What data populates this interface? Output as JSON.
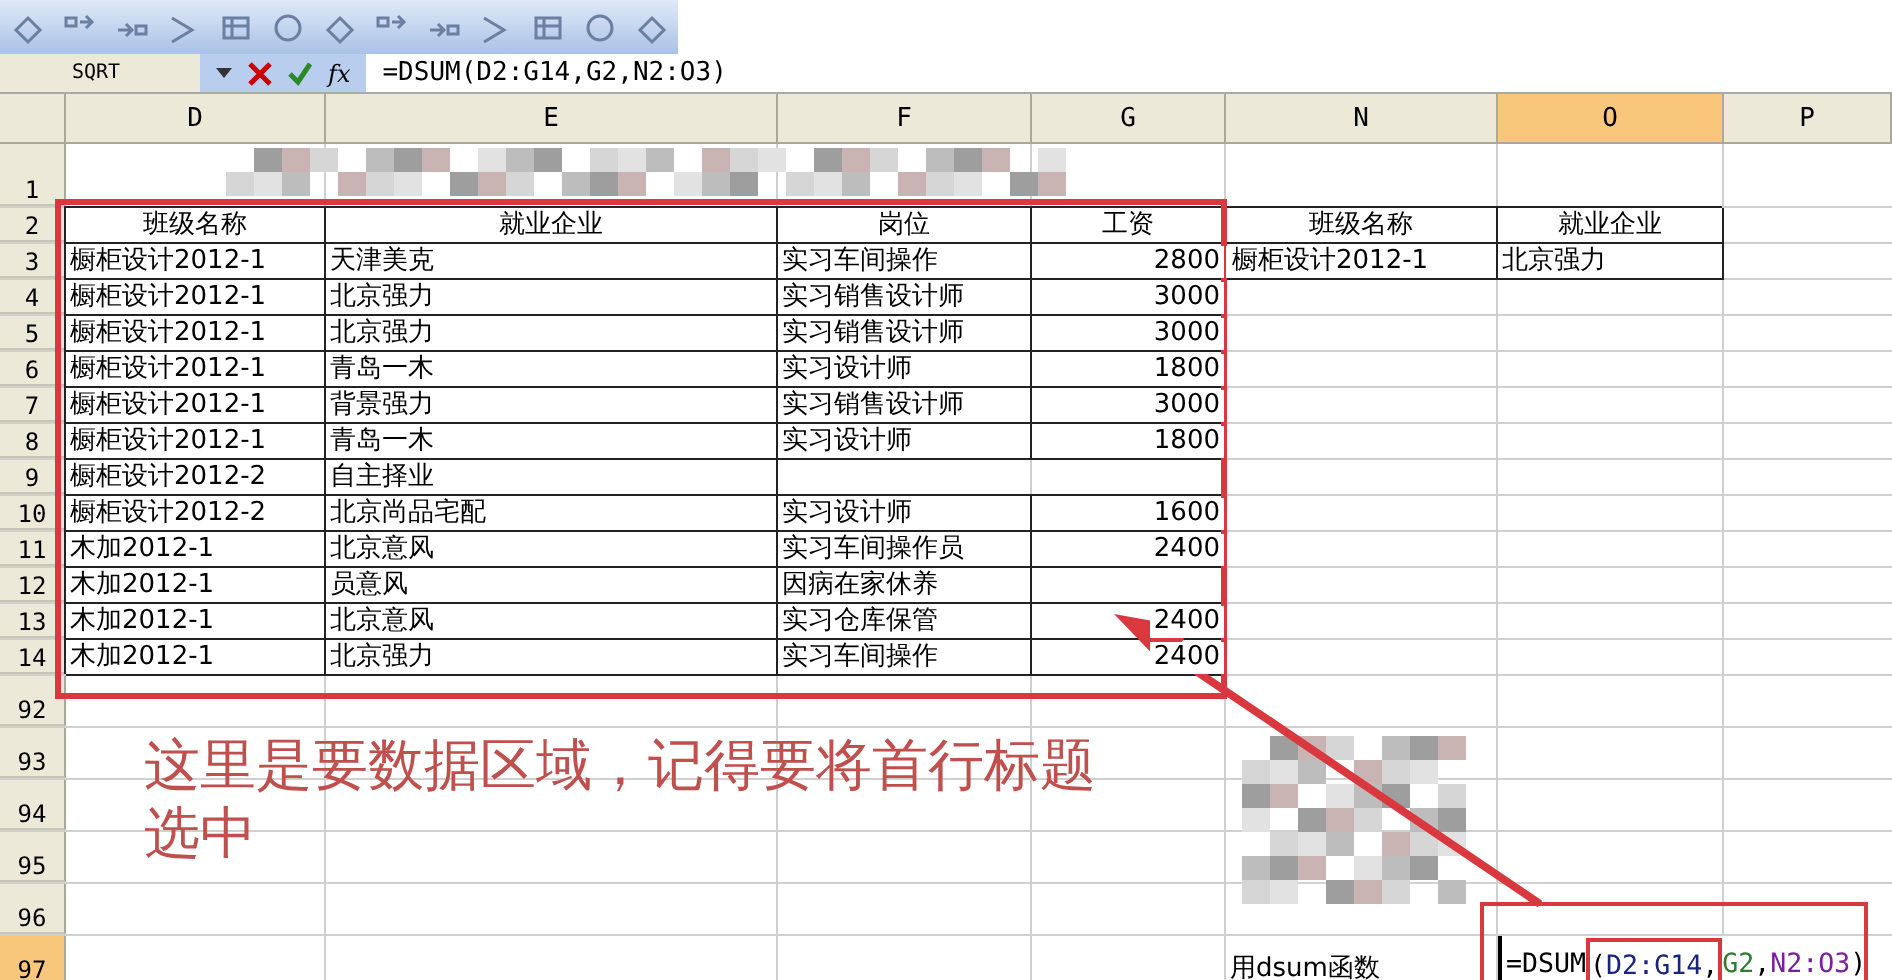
{
  "formula_bar": {
    "name_box": "SQRT",
    "function_label": "fx",
    "formula": "=DSUM(D2:G14,G2,N2:O3)"
  },
  "columns": [
    {
      "label": "D",
      "selected": false
    },
    {
      "label": "E",
      "selected": false
    },
    {
      "label": "F",
      "selected": false
    },
    {
      "label": "G",
      "selected": false
    },
    {
      "label": "N",
      "selected": false
    },
    {
      "label": "O",
      "selected": true
    },
    {
      "label": "P",
      "selected": false
    }
  ],
  "rows": [
    {
      "number": "1",
      "selected": false,
      "cells": [
        {
          "kind": "blurred"
        },
        null,
        null,
        null,
        null,
        null,
        null
      ]
    },
    {
      "number": "2",
      "selected": false,
      "cells": [
        {
          "text": "班级名称",
          "centered": true,
          "boxed": true
        },
        {
          "text": "就业企业",
          "centered": true,
          "boxed": true
        },
        {
          "text": "岗位",
          "centered": true,
          "boxed": true
        },
        {
          "text": "工资",
          "centered": true,
          "boxed": true
        },
        {
          "text": "班级名称",
          "centered": true,
          "boxed": true
        },
        {
          "text": "就业企业",
          "centered": true,
          "boxed": true
        },
        null
      ]
    },
    {
      "number": "3",
      "selected": false,
      "cells": [
        {
          "text": "橱柜设计2012-1",
          "boxed": true
        },
        {
          "text": "天津美克",
          "boxed": true
        },
        {
          "text": "实习车间操作",
          "boxed": true
        },
        {
          "text": "2800",
          "numeric": true,
          "boxed": true
        },
        {
          "text": "橱柜设计2012-1",
          "boxed": true
        },
        {
          "text": "北京强力",
          "boxed": true
        },
        null
      ]
    },
    {
      "number": "4",
      "selected": false,
      "cells": [
        {
          "text": "橱柜设计2012-1",
          "boxed": true
        },
        {
          "text": "北京强力",
          "boxed": true
        },
        {
          "text": "实习销售设计师",
          "boxed": true
        },
        {
          "text": "3000",
          "numeric": true,
          "boxed": true
        },
        null,
        null,
        null
      ]
    },
    {
      "number": "5",
      "selected": false,
      "cells": [
        {
          "text": "橱柜设计2012-1",
          "boxed": true
        },
        {
          "text": "北京强力",
          "boxed": true
        },
        {
          "text": "实习销售设计师",
          "boxed": true
        },
        {
          "text": "3000",
          "numeric": true,
          "boxed": true
        },
        null,
        null,
        null
      ]
    },
    {
      "number": "6",
      "selected": false,
      "cells": [
        {
          "text": "橱柜设计2012-1",
          "boxed": true
        },
        {
          "text": "青岛一木",
          "boxed": true
        },
        {
          "text": "实习设计师",
          "boxed": true
        },
        {
          "text": "1800",
          "numeric": true,
          "boxed": true
        },
        null,
        null,
        null
      ]
    },
    {
      "number": "7",
      "selected": false,
      "cells": [
        {
          "text": "橱柜设计2012-1",
          "boxed": true
        },
        {
          "text": "背景强力",
          "boxed": true
        },
        {
          "text": "实习销售设计师",
          "boxed": true
        },
        {
          "text": "3000",
          "numeric": true,
          "boxed": true
        },
        null,
        null,
        null
      ]
    },
    {
      "number": "8",
      "selected": false,
      "cells": [
        {
          "text": "橱柜设计2012-1",
          "boxed": true
        },
        {
          "text": "青岛一木",
          "boxed": true
        },
        {
          "text": "实习设计师",
          "boxed": true
        },
        {
          "text": "1800",
          "numeric": true,
          "boxed": true
        },
        null,
        null,
        null
      ]
    },
    {
      "number": "9",
      "selected": false,
      "cells": [
        {
          "text": "橱柜设计2012-2",
          "boxed": true
        },
        {
          "text": "自主择业",
          "boxed": true
        },
        null,
        null,
        null,
        null,
        null
      ]
    },
    {
      "number": "10",
      "selected": false,
      "cells": [
        {
          "text": "橱柜设计2012-2",
          "boxed": true
        },
        {
          "text": "北京尚品宅配",
          "boxed": true
        },
        {
          "text": "实习设计师",
          "boxed": true
        },
        {
          "text": "1600",
          "numeric": true,
          "boxed": true
        },
        null,
        null,
        null
      ]
    },
    {
      "number": "11",
      "selected": false,
      "cells": [
        {
          "text": "木加2012-1",
          "boxed": true
        },
        {
          "text": "北京意风",
          "boxed": true
        },
        {
          "text": "实习车间操作员",
          "boxed": true
        },
        {
          "text": "2400",
          "numeric": true,
          "boxed": true
        },
        null,
        null,
        null
      ]
    },
    {
      "number": "12",
      "selected": false,
      "cells": [
        {
          "text": "木加2012-1",
          "boxed": true
        },
        {
          "text": "员意风",
          "boxed": true
        },
        {
          "text": "因病在家休养",
          "boxed": true
        },
        null,
        null,
        null,
        null
      ]
    },
    {
      "number": "13",
      "selected": false,
      "cells": [
        {
          "text": "木加2012-1",
          "boxed": true
        },
        {
          "text": "北京意风",
          "boxed": true
        },
        {
          "text": "实习仓库保管",
          "boxed": true
        },
        {
          "text": "2400",
          "numeric": true,
          "boxed": true
        },
        null,
        null,
        null
      ]
    },
    {
      "number": "14",
      "selected": false,
      "cells": [
        {
          "text": "木加2012-1",
          "boxed": true
        },
        {
          "text": "北京强力",
          "boxed": true
        },
        {
          "text": "实习车间操作",
          "boxed": true
        },
        {
          "text": "2400",
          "numeric": true,
          "boxed": true
        },
        null,
        null,
        null
      ]
    },
    {
      "number": "92",
      "selected": false,
      "cells": [
        null,
        null,
        null,
        null,
        null,
        null,
        null
      ]
    },
    {
      "number": "93",
      "selected": false,
      "cells": [
        null,
        null,
        null,
        null,
        {
          "kind": "blurred"
        },
        null,
        null
      ]
    },
    {
      "number": "94",
      "selected": false,
      "cells": [
        null,
        null,
        null,
        null,
        null,
        null,
        null
      ]
    },
    {
      "number": "95",
      "selected": false,
      "cells": [
        null,
        null,
        null,
        null,
        null,
        null,
        null
      ]
    },
    {
      "number": "96",
      "selected": false,
      "cells": [
        null,
        null,
        null,
        null,
        null,
        null,
        null
      ]
    },
    {
      "number": "97",
      "selected": true,
      "cells": [
        null,
        null,
        null,
        null,
        {
          "text": "用dsum函数"
        },
        {
          "kind": "formula-edit",
          "parts": [
            {
              "text": "=DSUM",
              "color": "#000000",
              "framed": false
            },
            {
              "text": "(",
              "color": "#000000",
              "framed": true
            },
            {
              "text": "D2:G14",
              "color": "#1a237e",
              "framed": true
            },
            {
              "text": ",",
              "color": "#000000",
              "framed": true
            },
            {
              "text": "G2",
              "color": "#2e7d32",
              "framed": false
            },
            {
              "text": ",",
              "color": "#000000",
              "framed": false
            },
            {
              "text": "N2:O3",
              "color": "#7b1fa2",
              "framed": false
            },
            {
              "text": ")",
              "color": "#000000",
              "framed": false
            }
          ]
        },
        null
      ]
    }
  ],
  "annotation": {
    "note": "这里是要数据区域，记得要将首行标题选中"
  }
}
